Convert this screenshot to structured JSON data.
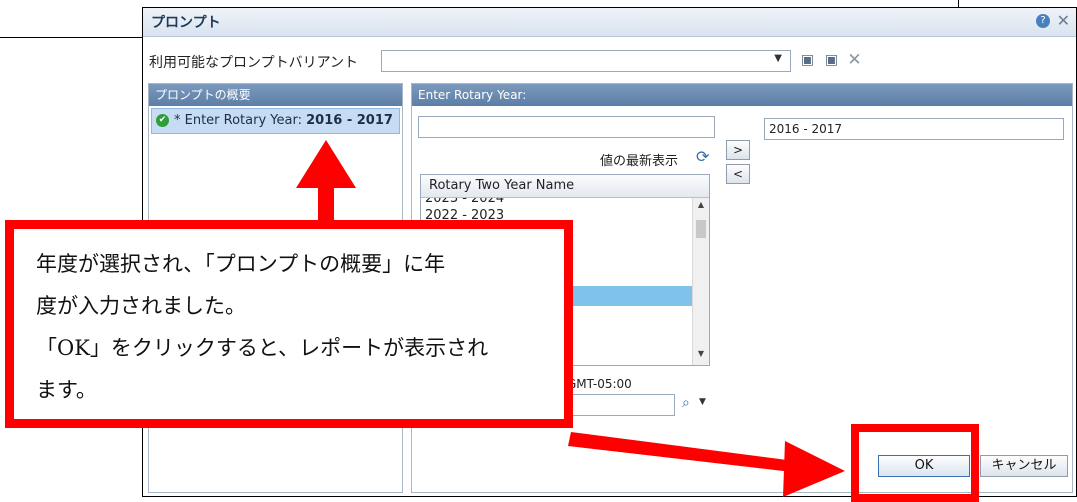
{
  "dialog": {
    "title": "プロンプト",
    "help_icon": "question-circle-icon",
    "close_icon": "close-icon"
  },
  "variant": {
    "label": "利用可能なプロンプトバリアント",
    "value": "",
    "icons": [
      "save-icon",
      "save-as-icon",
      "delete-icon"
    ]
  },
  "summary": {
    "header": "プロンプトの概要",
    "item_prefix": "* Enter Rotary Year: ",
    "item_value": "2016 - 2017"
  },
  "prompt": {
    "header": "Enter Rotary Year:",
    "search_value": "",
    "selected_value": "2016 - 2017",
    "refresh_label": "値の最新表示",
    "add_label": ">",
    "remove_label": "<",
    "list_header": "Rotary Two Year Name",
    "list_partial_row": "2023 - 2024",
    "list_rows": [
      "2022 - 2023",
      "",
      "",
      "",
      "",
      "",
      "",
      "",
      ""
    ],
    "timezone": "GMT-05:00",
    "bottom_search_value": ""
  },
  "buttons": {
    "ok": "OK",
    "cancel": "キャンセル"
  },
  "annotation": {
    "lines": [
      "年度が選択され、「プロンプトの概要」に年",
      "度が入力されました。",
      "「OK」をクリックすると、レポートが表示され",
      "ます。"
    ]
  },
  "colors": {
    "annotation_red": "#ff0000",
    "header_blue": "#5d7ea7",
    "selected_row": "#7fc3ea"
  }
}
